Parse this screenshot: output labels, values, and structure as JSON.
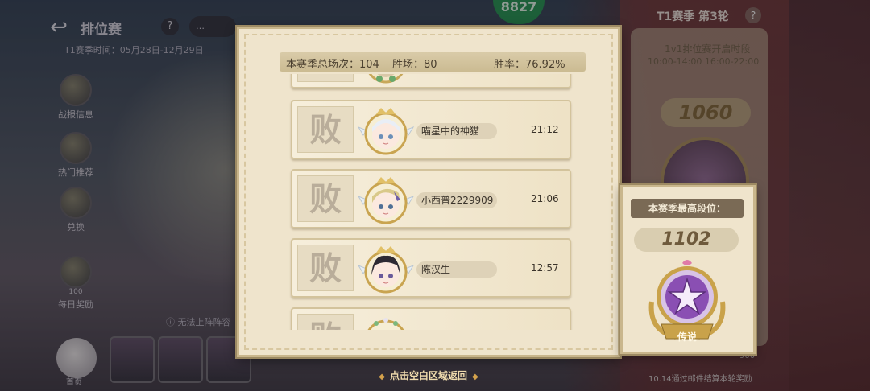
{
  "background": {
    "title": "排位赛",
    "help": "?",
    "chat_label": "…",
    "season_time": "T1赛季时间：05月28日-12月29日",
    "top_score": "8827",
    "side_menu": [
      {
        "label": "战报信息"
      },
      {
        "label": "热门推荐"
      },
      {
        "label": "兑换"
      },
      {
        "label": "每日奖励"
      }
    ],
    "daily_reward_count": "100",
    "bottom_note": "无法上阵阵容",
    "bottom_left_label": "首页",
    "right_panel": {
      "title": "T1赛季 第3轮",
      "help": "?",
      "open_title": "1v1排位赛开启时段",
      "open_times": "10:00-14:00  16:00-22:00",
      "current_score": "1060",
      "settle_note": "10.14通过邮件结算本轮奖励",
      "bottom_count": "900"
    }
  },
  "modal": {
    "stats": {
      "total": "本赛季总场次：104",
      "wins": "胜场：80",
      "rate": "胜率：76.92%"
    },
    "matches": [
      {
        "result": "败",
        "name": "",
        "time": ""
      },
      {
        "result": "败",
        "name": "喵星中的神猫",
        "time": "21:12"
      },
      {
        "result": "败",
        "name": "小西普2229909",
        "time": "21:06"
      },
      {
        "result": "败",
        "name": "陈汉生",
        "time": "12:57"
      },
      {
        "result": "败",
        "name": "",
        "time": ""
      }
    ],
    "return_hint": "点击空白区域返回"
  },
  "best_rank": {
    "title": "本赛季最高段位：",
    "score": "1102",
    "rank_name": "传说"
  },
  "colors": {
    "parchment": "#efe4cc",
    "border_gold": "#c9b68c",
    "legend_purple": "#8a4fb3",
    "green_score": "#2f9a5c"
  }
}
